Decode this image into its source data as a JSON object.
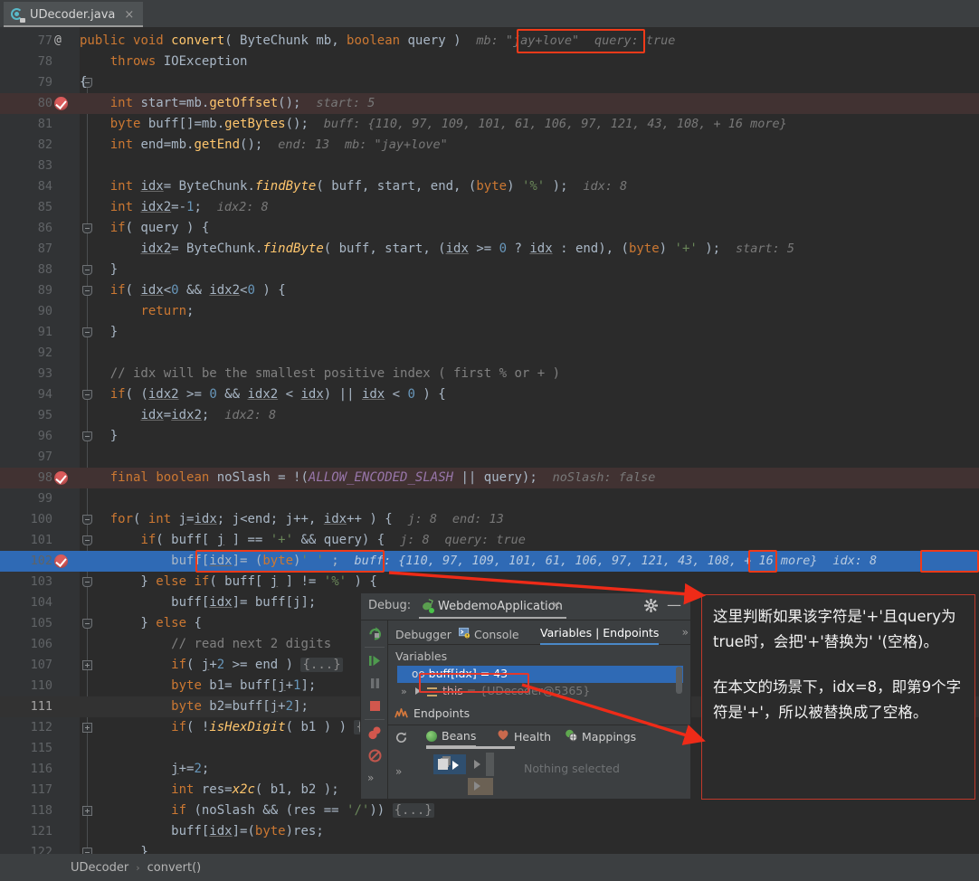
{
  "tab": {
    "filename": "UDecoder.java",
    "close": "×",
    "icon": "java-class-icon"
  },
  "editor": {
    "lines": [
      {
        "n": "77",
        "mark": "at",
        "fold": "",
        "indent": 0,
        "html": "<span class='kw'>public</span> <span class='kw'>void</span> <span class='mthn'>convert</span>( ByteChunk mb, <span class='kw'>boolean</span> query )",
        "hints": [
          {
            "text": "mb: \"jay+love\"",
            "boxed": true
          },
          {
            "text": "query: true",
            "boxed": false
          }
        ]
      },
      {
        "n": "78",
        "mark": "",
        "fold": "",
        "indent": 0,
        "html": "    <span class='kw'>throws</span> IOException",
        "hints": []
      },
      {
        "n": "79",
        "mark": "",
        "fold": "minus",
        "indent": 0,
        "html": "{",
        "hints": []
      },
      {
        "n": "80",
        "mark": "bp",
        "fold": "",
        "indent": 0,
        "bg": "exec",
        "html": "    <span class='kw'>int</span> start=mb.<span class='mthn'>getOffset</span>();",
        "hints": [
          {
            "text": "start: 5",
            "boxed": false
          }
        ]
      },
      {
        "n": "81",
        "mark": "",
        "fold": "",
        "indent": 0,
        "html": "    <span class='kw'>byte</span> buff[]=mb.<span class='mthn'>getBytes</span>();",
        "hints": [
          {
            "text": "buff: {110, 97, 109, 101, 61, 106, 97, 121, 43, 108, + 16 more}",
            "boxed": false
          }
        ]
      },
      {
        "n": "82",
        "mark": "",
        "fold": "",
        "indent": 0,
        "html": "    <span class='kw'>int</span> end=mb.<span class='mthn'>getEnd</span>();",
        "hints": [
          {
            "text": "end: 13",
            "boxed": false
          },
          {
            "text": "mb: \"jay+love\"",
            "boxed": false
          }
        ]
      },
      {
        "n": "83",
        "mark": "",
        "fold": "",
        "indent": 0,
        "html": "",
        "hints": []
      },
      {
        "n": "84",
        "mark": "",
        "fold": "",
        "indent": 0,
        "html": "    <span class='kw'>int</span> <span class='lv'>idx</span>= ByteChunk.<span class='mth'>findByte</span>( buff, start, end, (<span class='kw'>byte</span>) <span class='str'>'%'</span> );",
        "hints": [
          {
            "text": "idx: 8",
            "boxed": false
          }
        ]
      },
      {
        "n": "85",
        "mark": "",
        "fold": "",
        "indent": 0,
        "html": "    <span class='kw'>int</span> <span class='lv'>idx2</span>=-<span class='num'>1</span>;",
        "hints": [
          {
            "text": "idx2: 8",
            "boxed": false
          }
        ]
      },
      {
        "n": "86",
        "mark": "",
        "fold": "minus",
        "indent": 0,
        "html": "    <span class='kw'>if</span>( query ) {",
        "hints": []
      },
      {
        "n": "87",
        "mark": "",
        "fold": "",
        "indent": 0,
        "html": "        <span class='lv'>idx2</span>= ByteChunk.<span class='mth'>findByte</span>( buff, start, (<span class='lv'>idx</span> &gt;= <span class='num'>0</span> ? <span class='lv'>idx</span> : end), (<span class='kw'>byte</span>) <span class='str'>'+'</span> );",
        "hints": [
          {
            "text": "start: 5",
            "boxed": false
          }
        ]
      },
      {
        "n": "88",
        "mark": "",
        "fold": "plus-end",
        "indent": 0,
        "html": "    }",
        "hints": []
      },
      {
        "n": "89",
        "mark": "",
        "fold": "minus",
        "indent": 0,
        "html": "    <span class='kw'>if</span>( <span class='lv'>idx</span>&lt;<span class='num'>0</span> &amp;&amp; <span class='lv'>idx2</span>&lt;<span class='num'>0</span> ) {",
        "hints": []
      },
      {
        "n": "90",
        "mark": "",
        "fold": "",
        "indent": 0,
        "html": "        <span class='kw'>return</span>;",
        "hints": []
      },
      {
        "n": "91",
        "mark": "",
        "fold": "plus-end",
        "indent": 0,
        "html": "    }",
        "hints": []
      },
      {
        "n": "92",
        "mark": "",
        "fold": "",
        "indent": 0,
        "html": "",
        "hints": []
      },
      {
        "n": "93",
        "mark": "",
        "fold": "",
        "indent": 0,
        "html": "    <span class='cmt'>// idx will be the smallest positive index ( first % or + )</span>",
        "hints": []
      },
      {
        "n": "94",
        "mark": "",
        "fold": "minus",
        "indent": 0,
        "html": "    <span class='kw'>if</span>( (<span class='lv'>idx2</span> &gt;= <span class='num'>0</span> &amp;&amp; <span class='lv'>idx2</span> &lt; <span class='lv'>idx</span>) || <span class='lv'>idx</span> &lt; <span class='num'>0</span> ) {",
        "hints": []
      },
      {
        "n": "95",
        "mark": "",
        "fold": "",
        "indent": 0,
        "html": "        <span class='lv'>idx</span>=<span class='lv'>idx2</span>;",
        "hints": [
          {
            "text": "idx2: 8",
            "boxed": false
          }
        ]
      },
      {
        "n": "96",
        "mark": "",
        "fold": "plus-end",
        "indent": 0,
        "html": "    }",
        "hints": []
      },
      {
        "n": "97",
        "mark": "",
        "fold": "",
        "indent": 0,
        "html": "",
        "hints": []
      },
      {
        "n": "98",
        "mark": "bp",
        "fold": "",
        "indent": 0,
        "bg": "exec",
        "html": "    <span class='kw'>final</span> <span class='kw'>boolean</span> noSlash = !(<span class='sfld'>ALLOW_ENCODED_SLASH</span> || query);",
        "hints": [
          {
            "text": "noSlash: false",
            "boxed": false
          }
        ]
      },
      {
        "n": "99",
        "mark": "",
        "fold": "",
        "indent": 0,
        "html": "",
        "hints": []
      },
      {
        "n": "100",
        "mark": "",
        "fold": "minus",
        "indent": 0,
        "html": "    <span class='kw'>for</span>( <span class='kw'>int</span> <span class='lv'>j</span>=<span class='lv'>idx</span>; j&lt;end; j++, <span class='lv'>idx</span>++ ) {",
        "hints": [
          {
            "text": "j: 8",
            "boxed": false
          },
          {
            "text": "end: 13",
            "boxed": false
          }
        ]
      },
      {
        "n": "101",
        "mark": "",
        "fold": "minus",
        "indent": 0,
        "html": "        <span class='kw'>if</span>( buff[ <span class='lv'>j</span> ] == <span class='str'>'+'</span> &amp;&amp; query) {",
        "hints": [
          {
            "text": "j: 8",
            "boxed": false
          },
          {
            "text": "query: true",
            "boxed": false
          }
        ]
      },
      {
        "n": "102",
        "mark": "bp",
        "fold": "",
        "indent": 0,
        "bg": "sel",
        "html": "            buff[<span class='lv'>idx</span>]= (<span class='kw'>byte</span>)<span class='str'>' '</span> ;",
        "hints": [
          {
            "text": "buff: {110, 97, 109, 101, 61, 106, 97, 121, 43, 108, + 16 more}",
            "boxed": false,
            "selected": true
          },
          {
            "text": "idx: 8",
            "boxed": true,
            "selected": true
          }
        ]
      },
      {
        "n": "103",
        "mark": "",
        "fold": "plus-end",
        "indent": 0,
        "html": "        } <span class='kw'>else</span> <span class='kw'>if</span>( buff[ <span class='lv'>j</span> ] != <span class='str'>'%'</span> ) {",
        "hints": []
      },
      {
        "n": "104",
        "mark": "",
        "fold": "",
        "indent": 0,
        "html": "            buff[<span class='lv'>idx</span>]= buff[j];",
        "hints": []
      },
      {
        "n": "105",
        "mark": "",
        "fold": "plus-end",
        "indent": 0,
        "html": "        } <span class='kw'>else</span> {",
        "hints": []
      },
      {
        "n": "106",
        "mark": "",
        "fold": "",
        "indent": 0,
        "html": "            <span class='cmt'>// read next 2 digits</span>",
        "hints": []
      },
      {
        "n": "107",
        "mark": "",
        "fold": "plus",
        "indent": 0,
        "html": "            <span class='kw'>if</span>( <span class='lv'>j</span>+<span class='num'>2</span> &gt;= end ) <span class='fold-inline'>{...}</span>",
        "hints": []
      },
      {
        "n": "110",
        "mark": "",
        "fold": "",
        "indent": 0,
        "html": "            <span class='kw'>byte</span> b1= buff[<span class='lv'>j</span>+<span class='num'>1</span>];",
        "hints": []
      },
      {
        "n": "111",
        "mark": "",
        "fold": "",
        "indent": 0,
        "bg": "cursor",
        "current": true,
        "html": "            <span class='kw'>byte</span> b2=buff[<span class='lv'>j</span>+<span class='num'>2</span>];",
        "hints": []
      },
      {
        "n": "112",
        "mark": "",
        "fold": "plus",
        "indent": 0,
        "html": "            <span class='kw'>if</span>( !<span class='mth'>isHexDigit</span>( b1 ) ) <span class='fold-inline'>{...}</span>",
        "hints": []
      },
      {
        "n": "115",
        "mark": "",
        "fold": "",
        "indent": 0,
        "html": "",
        "hints": []
      },
      {
        "n": "116",
        "mark": "",
        "fold": "",
        "indent": 0,
        "html": "            <span class='lv'>j</span>+=<span class='num'>2</span>;",
        "hints": []
      },
      {
        "n": "117",
        "mark": "",
        "fold": "",
        "indent": 0,
        "html": "            <span class='kw'>int</span> res=<span class='mth'>x2c</span>( b1, b2 );",
        "hints": []
      },
      {
        "n": "118",
        "mark": "",
        "fold": "plus",
        "indent": 0,
        "html": "            <span class='kw'>if</span> (noSlash &amp;&amp; (res == <span class='str'>'/'</span>)) <span class='fold-inline'>{...}</span>",
        "hints": []
      },
      {
        "n": "121",
        "mark": "",
        "fold": "",
        "indent": 0,
        "html": "            buff[<span class='lv'>idx</span>]=(<span class='kw'>byte</span>)res;",
        "hints": []
      },
      {
        "n": "122",
        "mark": "",
        "fold": "minus",
        "indent": 0,
        "html": "        }",
        "hints": []
      }
    ]
  },
  "debug_window": {
    "label": "Debug:",
    "config_name": "WebdemoApplication",
    "close": "×",
    "gear_icon": "gear-icon",
    "minimize_icon": "minimize-icon",
    "tabs": [
      {
        "label": "Debugger",
        "active": false,
        "icon": ""
      },
      {
        "label": "Console",
        "active": false,
        "icon": "console-icon"
      },
      {
        "label": "Variables | Endpoints",
        "active": true,
        "icon": ""
      }
    ],
    "more_tabs": "»",
    "variables_title": "Variables",
    "variables": [
      {
        "prefix": "oo",
        "name": "buff[idx]",
        "value": "= 43",
        "selected": true
      },
      {
        "name": "this",
        "value": "= {UDecoder@5365}",
        "selected": false
      }
    ],
    "endpoints_label": "Endpoints",
    "sub_tabs": [
      {
        "label": "Beans",
        "active": true,
        "icon": "beans-icon"
      },
      {
        "label": "Health",
        "active": false,
        "icon": "health-icon"
      },
      {
        "label": "Mappings",
        "active": false,
        "icon": "mappings-icon"
      }
    ],
    "empty_text": "Nothing selected",
    "toolbar_icons": [
      "rerun-icon",
      "resume-icon",
      "pause-icon",
      "stop-icon",
      "view-breakpoints-icon",
      "mute-breakpoints-icon",
      "more-icon"
    ]
  },
  "annotation": {
    "paragraph1": "这里判断如果该字符是'+'且query为true时，会把'+'替换为' '(空格)。",
    "paragraph2": "在本文的场景下，idx=8，即第9个字符是'+'，所以被替换成了空格。",
    "border_color": "#c0392b"
  },
  "breadcrumb": {
    "class_name": "UDecoder",
    "separator": "›",
    "method_name": "convert()"
  },
  "colors": {
    "editor_bg": "#2b2b2b",
    "gutter_bg": "#313335",
    "panel_bg": "#3c3f41",
    "selection_blue": "#2f6ab5",
    "exec_line": "#413232",
    "accent_red": "#f03a19",
    "keyword_orange": "#cc7832",
    "string_green": "#6a8759",
    "number_blue": "#6897bb",
    "method_yellow": "#ffc66d",
    "hint_gray": "#787878"
  }
}
